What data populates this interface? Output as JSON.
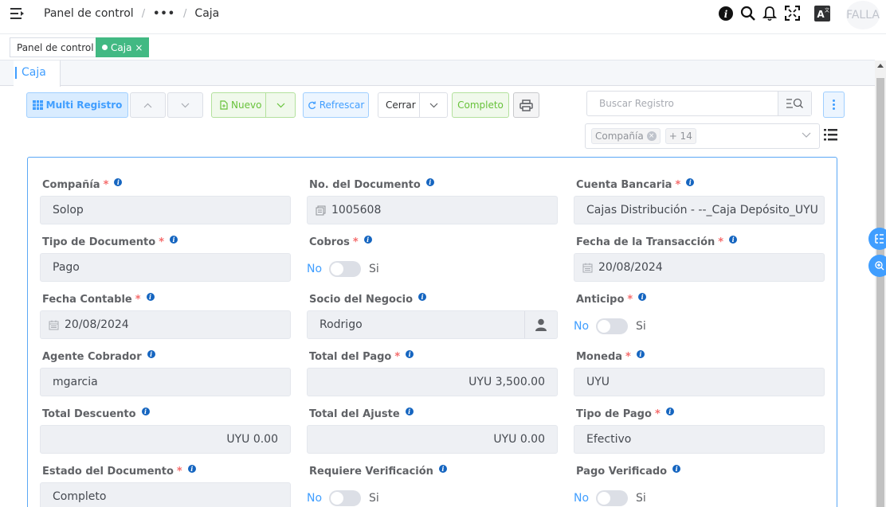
{
  "header": {
    "breadcrumb_root": "Panel de control",
    "breadcrumb_more": "•••",
    "breadcrumb_current": "Caja",
    "fallback_avatar": "FALLA"
  },
  "tags": {
    "home": "Panel de control",
    "active": "Caja",
    "close": "×"
  },
  "panel": {
    "tab_label": "Caja"
  },
  "toolbar": {
    "multi_registro": "Multi Registro",
    "nuevo": "Nuevo",
    "refrescar": "Refrescar",
    "cerrar": "Cerrar",
    "completo": "Completo",
    "search_placeholder": "Buscar Registro",
    "filter_chip": "Compañía",
    "filter_more": "+ 14"
  },
  "form": {
    "compania": {
      "label": "Compañía",
      "value": "Solop"
    },
    "no_documento": {
      "label": "No. del Documento",
      "value": "1005608"
    },
    "cuenta_bancaria": {
      "label": "Cuenta Bancaria",
      "value": "Cajas Distribución - --_Caja Depósito_UYU"
    },
    "tipo_documento": {
      "label": "Tipo de Documento",
      "value": "Pago"
    },
    "cobros": {
      "label": "Cobros",
      "off": "No",
      "on": "Si"
    },
    "fecha_transaccion": {
      "label": "Fecha de la Transacción",
      "value": "20/08/2024"
    },
    "fecha_contable": {
      "label": "Fecha Contable",
      "value": "20/08/2024"
    },
    "socio_negocio": {
      "label": "Socio del Negocio",
      "value": "Rodrigo"
    },
    "anticipo": {
      "label": "Anticipo",
      "off": "No",
      "on": "Si"
    },
    "agente_cobrador": {
      "label": "Agente Cobrador",
      "value": "mgarcia"
    },
    "total_pago": {
      "label": "Total del Pago",
      "value": "UYU 3,500.00"
    },
    "moneda": {
      "label": "Moneda",
      "value": "UYU"
    },
    "total_descuento": {
      "label": "Total Descuento",
      "value": "UYU 0.00"
    },
    "total_ajuste": {
      "label": "Total del Ajuste",
      "value": "UYU 0.00"
    },
    "tipo_pago": {
      "label": "Tipo de Pago",
      "value": "Efectivo"
    },
    "estado_documento": {
      "label": "Estado del Documento",
      "value": "Completo"
    },
    "requiere_verificacion": {
      "label": "Requiere Verificación",
      "off": "No",
      "on": "Si"
    },
    "pago_verificado": {
      "label": "Pago Verificado",
      "off": "No",
      "on": "Si"
    }
  },
  "icons": {
    "info": "i",
    "colors": {
      "primary": "#409eff",
      "success": "#67c23a",
      "danger": "#f56c6c"
    }
  }
}
